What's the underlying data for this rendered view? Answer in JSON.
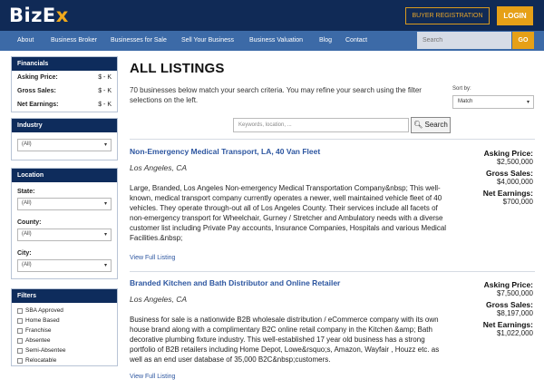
{
  "header": {
    "logo_part1": "BizE",
    "logo_part2": "x",
    "buyer_registration": "BUYER REGISTRATION",
    "login": "LOGIN"
  },
  "nav": {
    "items": [
      "About",
      "Business Broker",
      "Businesses for Sale",
      "Sell Your Business",
      "Business Valuation",
      "Blog",
      "Contact"
    ],
    "search_placeholder": "Search",
    "go": "GO"
  },
  "sidebar": {
    "financials": {
      "title": "Financials",
      "rows": [
        {
          "label": "Asking Price:",
          "value": "$ - K"
        },
        {
          "label": "Gross Sales:",
          "value": "$ - K"
        },
        {
          "label": "Net Earnings:",
          "value": "$ - K"
        }
      ]
    },
    "industry": {
      "title": "Industry",
      "selected": "(All)"
    },
    "location": {
      "title": "Location",
      "state_label": "State:",
      "state_value": "(All)",
      "county_label": "County:",
      "county_value": "(All)",
      "city_label": "City:",
      "city_value": "(All)"
    },
    "filters": {
      "title": "Filters",
      "options": [
        "SBA Approved",
        "Home Based",
        "Franchise",
        "Absentee",
        "Semi-Absentee",
        "Relocatable"
      ]
    }
  },
  "main": {
    "title": "ALL LISTINGS",
    "intro": "70 businesses below match your search criteria. You may refine your search using the filter selections on the left.",
    "sort_label": "Sort by:",
    "sort_value": "Match",
    "keyword_placeholder": "Keywords, location, ...",
    "search_button": "Search"
  },
  "listings": [
    {
      "title": "Non-Emergency Medical Transport, LA, 40 Van Fleet",
      "location": "Los Angeles, CA",
      "description": "Large, Branded, Los Angeles Non-emergency Medical Transportation Company&nbsp; This well-known, medical transport company currently operates a newer, well maintained vehicle fleet of 40 vehicles. They operate through-out all of Los Angeles County. Their services include all facets of non-emergency transport for Wheelchair, Gurney / Stretcher and Ambulatory needs with a diverse customer list including Private Pay accounts, Insurance Companies, Hospitals and various Medical Facilities.&nbsp;",
      "link": "View Full Listing",
      "asking_label": "Asking Price:",
      "asking": "$2,500,000",
      "gross_label": "Gross Sales:",
      "gross": "$4,000,000",
      "net_label": "Net Earnings:",
      "net": "$700,000"
    },
    {
      "title": "Branded Kitchen and Bath Distributor and Online Retailer",
      "location": "Los Angeles, CA",
      "description": "Business for sale is a nationwide B2B wholesale distribution / eCommerce company with its own house brand along with a complimentary B2C online retail company in the Kitchen &amp; Bath decorative plumbing fixture industry. This well-established 17 year old business has a strong portfolio of B2B retailers including Home Depot, Lowe&rsquo;s, Amazon, Wayfair , Houzz etc. as well as an end user database of 35,000 B2C&nbsp;customers.",
      "link": "View Full Listing",
      "asking_label": "Asking Price:",
      "asking": "$7,500,000",
      "gross_label": "Gross Sales:",
      "gross": "$8,197,000",
      "net_label": "Net Earnings:",
      "net": "$1,022,000"
    }
  ]
}
